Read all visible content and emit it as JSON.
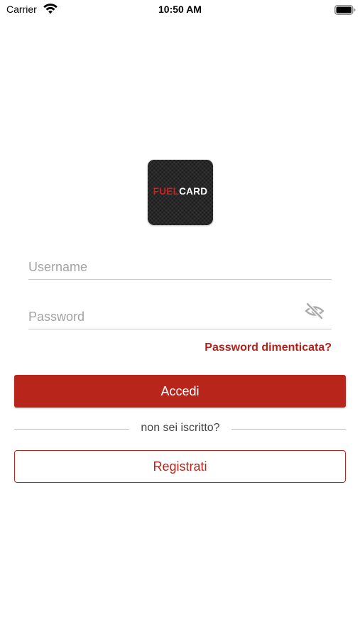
{
  "status_bar": {
    "carrier": "Carrier",
    "time": "10:50 AM",
    "icons": [
      "wifi-icon",
      "battery-icon"
    ]
  },
  "logo": {
    "part1": "FUEL",
    "part2": "CARD",
    "colors": {
      "part1": "#d0201b",
      "part2": "#ffffff",
      "background": "#1c1c1c"
    }
  },
  "login_form": {
    "username": {
      "placeholder": "Username",
      "value": ""
    },
    "password": {
      "placeholder": "Password",
      "value": "",
      "toggle_icon": "eye-slash-icon"
    },
    "forgot_password": "Password dimenticata?",
    "submit_label": "Accedi"
  },
  "divider_text": "non sei iscritto?",
  "register_label": "Registrati",
  "colors": {
    "accent": "#b8251a",
    "divider": "#bdbdbd",
    "placeholder": "#a3a3a3"
  }
}
